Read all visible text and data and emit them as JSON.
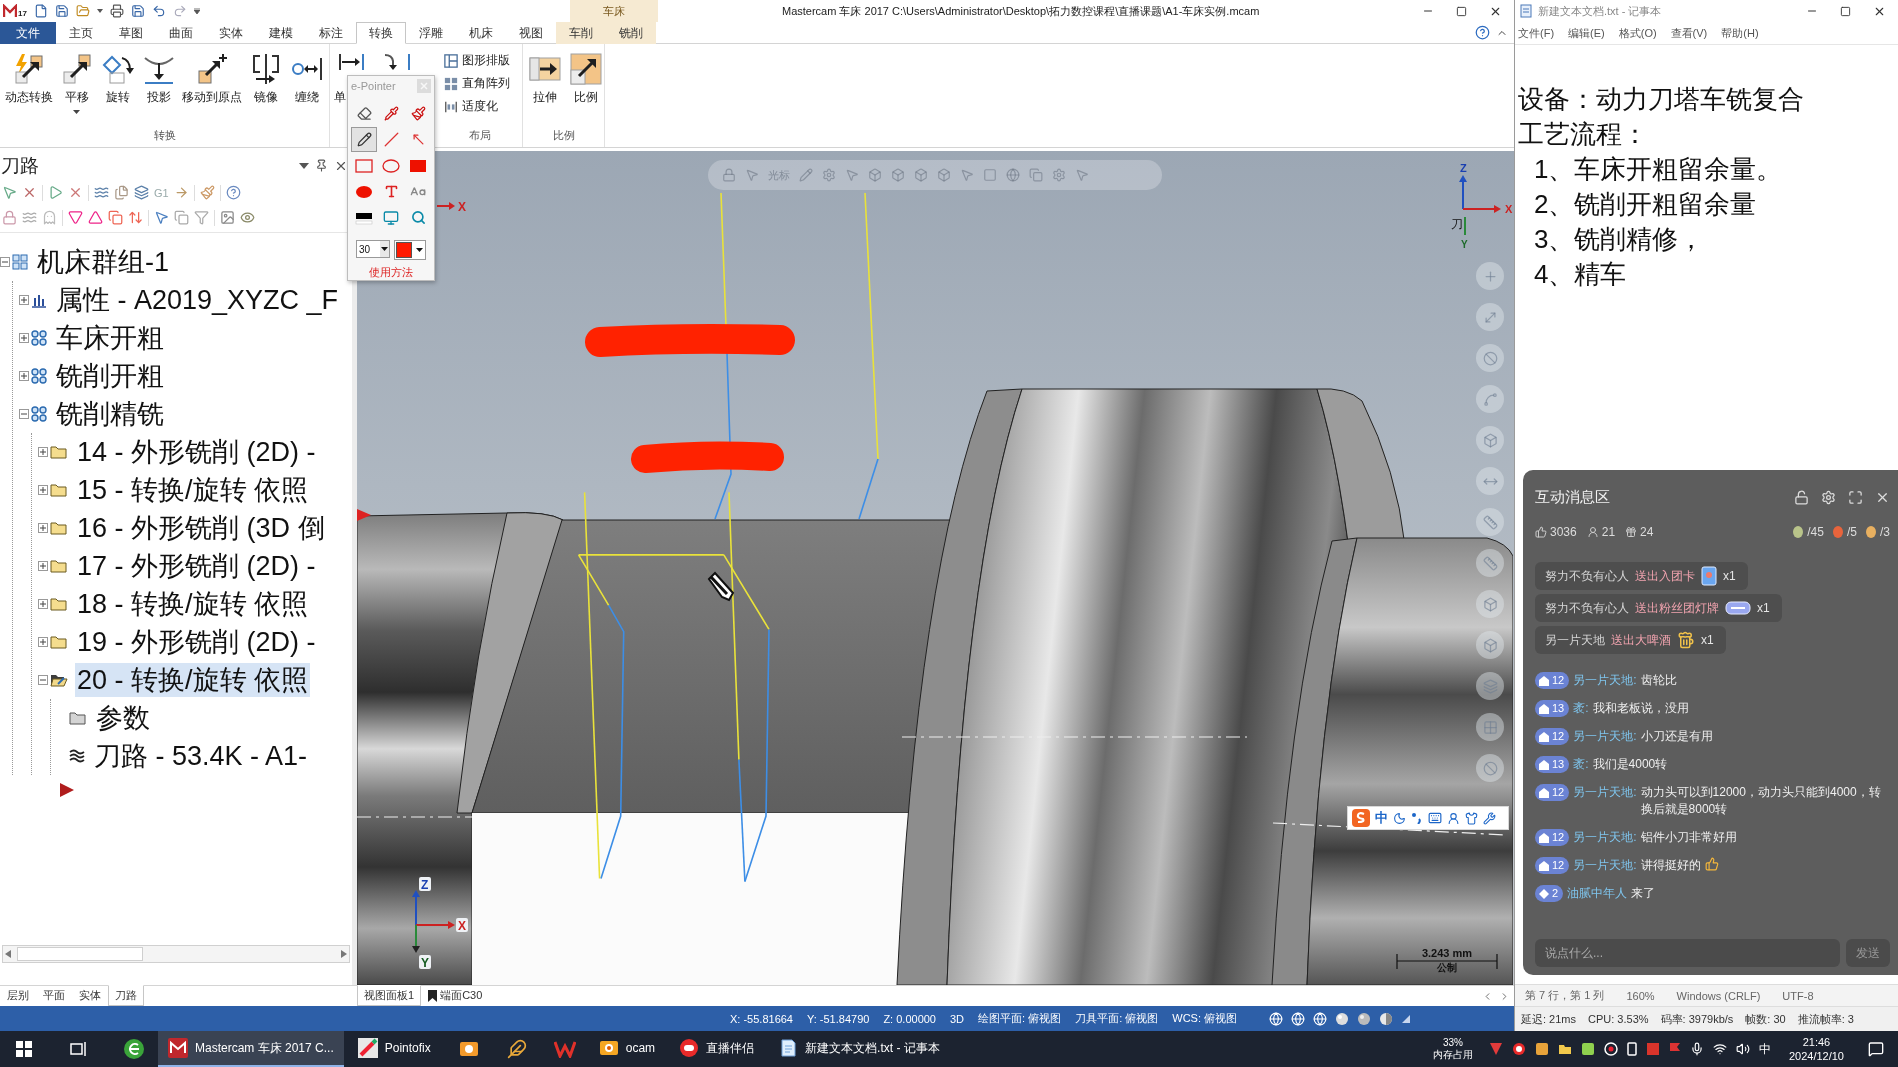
{
  "mastercam": {
    "logo_text": "17",
    "title": "Mastercam 车床 2017  C:\\Users\\Administrator\\Desktop\\拓力数控课程\\直播课题\\A1-车床实例.mcam",
    "context_group": "车床",
    "tabs": [
      {
        "label": "文件",
        "kind": "file",
        "selected": false
      },
      {
        "label": "主页",
        "kind": "tab",
        "selected": false
      },
      {
        "label": "草图",
        "kind": "tab",
        "selected": false
      },
      {
        "label": "曲面",
        "kind": "tab",
        "selected": false
      },
      {
        "label": "实体",
        "kind": "tab",
        "selected": false
      },
      {
        "label": "建模",
        "kind": "tab",
        "selected": false
      },
      {
        "label": "标注",
        "kind": "tab",
        "selected": false
      },
      {
        "label": "转换",
        "kind": "tab",
        "selected": true
      },
      {
        "label": "浮雕",
        "kind": "tab",
        "selected": false
      },
      {
        "label": "机床",
        "kind": "tab",
        "selected": false
      },
      {
        "label": "视图",
        "kind": "tab",
        "selected": false
      },
      {
        "label": "车削",
        "kind": "context",
        "selected": false
      },
      {
        "label": "铣削",
        "kind": "context",
        "selected": false
      }
    ],
    "ribbon_groups": [
      {
        "kind": "large",
        "title": "转换",
        "buttons": [
          {
            "label": "动态转换",
            "dropdown": false
          },
          {
            "label": "平移",
            "dropdown": true
          },
          {
            "label": "旋转",
            "dropdown": false
          },
          {
            "label": "投影",
            "dropdown": false
          },
          {
            "label": "移动到原点",
            "dropdown": false
          },
          {
            "label": "镜像",
            "dropdown": false
          },
          {
            "label": "缠绕",
            "dropdown": false
          }
        ]
      },
      {
        "kind": "covered",
        "buttons": [
          {
            "label": "单"
          }
        ]
      },
      {
        "kind": "small",
        "title": "布局",
        "buttons": [
          {
            "label": "图形排版"
          },
          {
            "label": "直角阵列"
          },
          {
            "label": "适度化"
          }
        ]
      },
      {
        "kind": "large",
        "title": "比例",
        "buttons": [
          {
            "label": "拉伸",
            "dropdown": false
          },
          {
            "label": "比例",
            "dropdown": false
          }
        ]
      }
    ]
  },
  "e_pointer": {
    "title": "e-Pointer",
    "tools": [
      {
        "selected": false
      },
      {
        "selected": false
      },
      {
        "selected": false
      },
      {
        "selected": true
      },
      {
        "selected": false
      },
      {
        "selected": false
      },
      {
        "selected": false
      },
      {
        "selected": false
      },
      {
        "selected": false
      },
      {
        "selected": false
      },
      {
        "selected": false
      },
      {
        "selected": false
      },
      {
        "selected": false
      },
      {
        "selected": false
      },
      {
        "selected": false
      }
    ],
    "pen_size": "30",
    "help": "使用方法"
  },
  "toolpath_manager": {
    "title": "刀路",
    "toolbar_text": "G1",
    "tree": [
      {
        "label": "机床群组-1",
        "kind": "machine-group",
        "expanded": true,
        "selected": false,
        "children": [
          {
            "label": "属性 - A2019_XYZC _F",
            "kind": "properties",
            "expanded": false,
            "selected": false
          },
          {
            "label": "车床开粗",
            "kind": "group",
            "expanded": false,
            "selected": false
          },
          {
            "label": "铣削开粗",
            "kind": "group",
            "expanded": false,
            "selected": false
          },
          {
            "label": "铣削精铣",
            "kind": "group",
            "expanded": true,
            "selected": false,
            "children": [
              {
                "label": "14 - 外形铣削 (2D) -",
                "kind": "operation",
                "expanded": false,
                "selected": false
              },
              {
                "label": "15 - 转换/旋转 依照",
                "kind": "operation",
                "expanded": false,
                "selected": false
              },
              {
                "label": "16 - 外形铣削 (3D 倒",
                "kind": "operation",
                "expanded": false,
                "selected": false
              },
              {
                "label": "17 - 外形铣削 (2D) -",
                "kind": "operation",
                "expanded": false,
                "selected": false
              },
              {
                "label": "18 - 转换/旋转 依照",
                "kind": "operation",
                "expanded": false,
                "selected": false
              },
              {
                "label": "19 - 外形铣削 (2D) -",
                "kind": "operation",
                "expanded": false,
                "selected": false
              },
              {
                "label": "20 - 转换/旋转 依照",
                "kind": "operation",
                "expanded": true,
                "selected": true,
                "children": [
                  {
                    "label": "参数",
                    "kind": "parameters",
                    "selected": false
                  },
                  {
                    "label": "刀路 - 53.4K - A1-",
                    "kind": "toolpath",
                    "selected": false
                  }
                ]
              }
            ]
          }
        ]
      }
    ],
    "bottom_tabs": [
      {
        "label": "层别",
        "selected": false
      },
      {
        "label": "平面",
        "selected": false
      },
      {
        "label": "实体",
        "selected": false
      },
      {
        "label": "刀路",
        "selected": true
      }
    ]
  },
  "viewport": {
    "toolbar_label": "光标",
    "origin_marker": "X",
    "view_axes": {
      "z": "Z",
      "x": "X",
      "y": "Y",
      "plane": "刀"
    },
    "world_axes": {
      "z": "Z",
      "x": "X",
      "y": "Y"
    },
    "scale": {
      "value": "3.243 mm",
      "unit": "公制"
    },
    "tabs": [
      {
        "label": "视图面板1",
        "selected": true
      },
      {
        "label": "端面C30",
        "selected": false
      }
    ]
  },
  "ime_bar": {
    "mode": "中"
  },
  "status_bar": {
    "fields": [
      "X: -55.81664",
      "Y: -51.84790",
      "Z: 0.00000",
      "3D",
      "绘图平面: 俯视图",
      "刀具平面: 俯视图",
      "WCS: 俯视图"
    ]
  },
  "notepad": {
    "title": "新建文本文档.txt - 记事本",
    "menus": [
      "文件(F)",
      "编辑(E)",
      "格式(O)",
      "查看(V)",
      "帮助(H)"
    ],
    "lines": [
      "设备：动力刀塔车铣复合",
      "工艺流程："
    ],
    "steps": [
      "1、车床开粗留余量。",
      "2、铣削开粗留余量",
      "3、铣削精修，",
      "4、精车"
    ],
    "status": [
      "第 7 行，第 1 列",
      "160%",
      "Windows (CRLF)",
      "UTF-8"
    ]
  },
  "chat": {
    "title": "互动消息区",
    "likes": "3036",
    "viewers": "21",
    "gifts": "24",
    "gift_tallies": [
      "/45",
      "/5",
      "/3"
    ],
    "gift_events": [
      {
        "user": "努力不负有心人",
        "action": "送出入团卡",
        "kind": "card",
        "count": "x1"
      },
      {
        "user": "努力不负有心人",
        "action": "送出粉丝团灯牌",
        "kind": "lamp",
        "count": "x1"
      },
      {
        "user": "另一片天地",
        "action": "送出大啤酒",
        "kind": "beer",
        "count": "x1"
      }
    ],
    "messages": [
      {
        "rank": "12",
        "user": "另一片天地:",
        "text": "齿轮比",
        "kind": "comment"
      },
      {
        "rank": "13",
        "user": "袤:",
        "text": "我和老板说，没用",
        "kind": "comment"
      },
      {
        "rank": "12",
        "user": "另一片天地:",
        "text": "小刀还是有用",
        "kind": "comment"
      },
      {
        "rank": "13",
        "user": "袤:",
        "text": "我们是4000转",
        "kind": "comment"
      },
      {
        "rank": "12",
        "user": "另一片天地:",
        "text": "动力头可以到12000，动力头只能到4000，转换后就是8000转",
        "kind": "comment"
      },
      {
        "rank": "12",
        "user": "另一片天地:",
        "text": "铝件小刀非常好用",
        "kind": "comment"
      },
      {
        "rank": "12",
        "user": "另一片天地:",
        "text": "讲得挺好的",
        "kind": "liked"
      },
      {
        "rank": "2",
        "user": "油腻中年人",
        "text": "来了",
        "kind": "join"
      }
    ],
    "input_placeholder": "说点什么...",
    "send": "发送"
  },
  "stream_stats": [
    "延迟: 21ms",
    "CPU: 3.53%",
    "码率: 3979kb/s",
    "帧数: 30",
    "推流帧率: 3"
  ],
  "taskbar": {
    "apps": [
      {
        "kind": "browser",
        "active": false
      },
      {
        "kind": "mastercam",
        "label": "Mastercam 车床 2017  C...",
        "active": true
      },
      {
        "kind": "pointofix",
        "label": "Pointofix",
        "active": false
      },
      {
        "kind": "viewer",
        "active": false
      },
      {
        "kind": "feather",
        "active": false
      },
      {
        "kind": "wps",
        "active": false
      },
      {
        "kind": "ocam",
        "label": "ocam",
        "active": false
      },
      {
        "kind": "live",
        "label": "直播伴侣",
        "active": false
      },
      {
        "kind": "notepad",
        "label": "新建文本文档.txt - 记事本",
        "active": false
      }
    ],
    "memory": {
      "value": "33%",
      "label": "内存占用"
    },
    "input_mode": "中",
    "time": "21:46",
    "date": "2024/12/10"
  }
}
